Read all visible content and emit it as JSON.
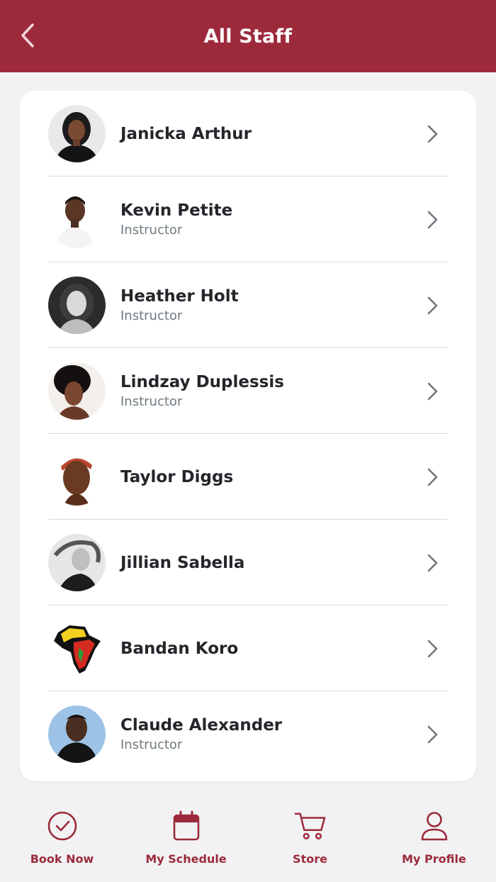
{
  "header": {
    "title": "All Staff"
  },
  "staff": [
    {
      "name": "Janicka Arthur",
      "role": "",
      "avatar": "photo-woman-dark"
    },
    {
      "name": "Kevin Petite",
      "role": "Instructor",
      "avatar": "photo-man"
    },
    {
      "name": "Heather Holt",
      "role": "Instructor",
      "avatar": "photo-woman-bw"
    },
    {
      "name": "Lindzay Duplessis",
      "role": "Instructor",
      "avatar": "photo-woman-curly"
    },
    {
      "name": "Taylor Diggs",
      "role": "",
      "avatar": "photo-woman-red-hair"
    },
    {
      "name": "Jillian Sabella",
      "role": "",
      "avatar": "photo-woman-bw-2"
    },
    {
      "name": "Bandan Koro",
      "role": "",
      "avatar": "africa-logo"
    },
    {
      "name": "Claude Alexander",
      "role": "Instructor",
      "avatar": "photo-man-2"
    }
  ],
  "nav": [
    {
      "label": "Book Now",
      "icon": "check-circle-icon"
    },
    {
      "label": "My Schedule",
      "icon": "calendar-icon"
    },
    {
      "label": "Store",
      "icon": "cart-icon"
    },
    {
      "label": "My Profile",
      "icon": "user-icon"
    }
  ],
  "colors": {
    "brand": "#9c2a3b",
    "text": "#24262b",
    "muted": "#6f7a80"
  }
}
